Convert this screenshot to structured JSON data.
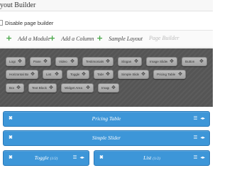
{
  "header": {
    "title": "yout Builder"
  },
  "disable_option": {
    "label": "Disable page builder"
  },
  "toolbar": {
    "items": [
      {
        "label": "Add a Module"
      },
      {
        "label": "Add a Column"
      },
      {
        "label": "Sample Layout"
      },
      {
        "label": "Page Builder"
      }
    ]
  },
  "modules": [
    "Logo",
    "Panel",
    "Video",
    "Testimonials",
    "Slogan",
    "Image Slider",
    "Button",
    "Horizontal Bar",
    "List",
    "Toggle",
    "Tabs",
    "Simple Slider",
    "Pricing Table",
    "Box",
    "Text Block",
    "Widget Area",
    "Image"
  ],
  "layout": {
    "rows": [
      {
        "label": "Pricing Table",
        "size": ""
      },
      {
        "label": "Simple Slider",
        "size": ""
      },
      {
        "label": "Toggle",
        "size": "(1/2)"
      },
      {
        "label": "List",
        "size": "(1/2)"
      }
    ]
  },
  "icons": {
    "add": "plus-icon",
    "move": "move-icon",
    "remove": "close-icon",
    "edit": "list-icon",
    "resize": "resize-icon"
  },
  "colors": {
    "accent_green": "#46a546",
    "layout_blue": "#3d96d8",
    "module_gray": "#b0b0b0",
    "canvas_dark": "#555555"
  }
}
